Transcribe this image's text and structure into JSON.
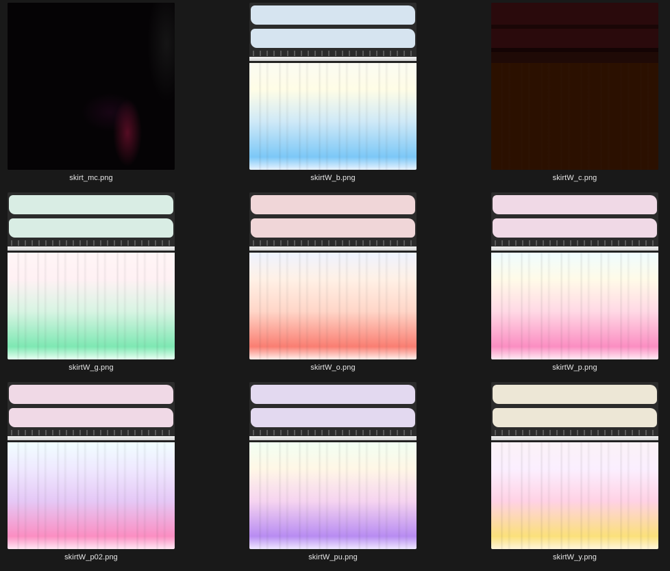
{
  "files": [
    {
      "name": "skirt_mc.png",
      "style": "dark_mc"
    },
    {
      "name": "skirtW_b.png",
      "style": "pastel",
      "band": "#d6e4f0",
      "grad": [
        "#fbfbf2",
        "#fffde6",
        "#cfe9f7",
        "#7cc8f7",
        "#e8f3ff"
      ]
    },
    {
      "name": "skirtW_c.png",
      "style": "dark_c"
    },
    {
      "name": "skirtW_g.png",
      "style": "pastel",
      "band": "#d9ede4",
      "grad": [
        "#fff5f6",
        "#fff1f4",
        "#d8f4e3",
        "#7ee8b3",
        "#e8fff2"
      ]
    },
    {
      "name": "skirtW_o.png",
      "style": "pastel",
      "band": "#f0d6d8",
      "grad": [
        "#eef3ff",
        "#fff1e6",
        "#ffd6c8",
        "#fa7e72",
        "#fff0ec"
      ]
    },
    {
      "name": "skirtW_p.png",
      "style": "pastel",
      "band": "#f0d9e6",
      "grad": [
        "#effcff",
        "#fffbe8",
        "#ffd9e5",
        "#fb8ec2",
        "#ffeaf4"
      ]
    },
    {
      "name": "skirtW_p02.png",
      "style": "pastel",
      "band": "#f0d9e6",
      "grad": [
        "#f0feff",
        "#efe9ff",
        "#e5c8f6",
        "#fb8ec2",
        "#ffe8f4"
      ]
    },
    {
      "name": "skirtW_pu.png",
      "style": "pastel",
      "band": "#e3d9f0",
      "grad": [
        "#f1fff3",
        "#fff7e6",
        "#f6d4f0",
        "#b88cf2",
        "#f0e8ff"
      ]
    },
    {
      "name": "skirtW_y.png",
      "style": "pastel",
      "band": "#ede7d6",
      "grad": [
        "#fbf2f7",
        "#fbefff",
        "#ffd2e5",
        "#fbe07a",
        "#fff6dc"
      ]
    }
  ]
}
